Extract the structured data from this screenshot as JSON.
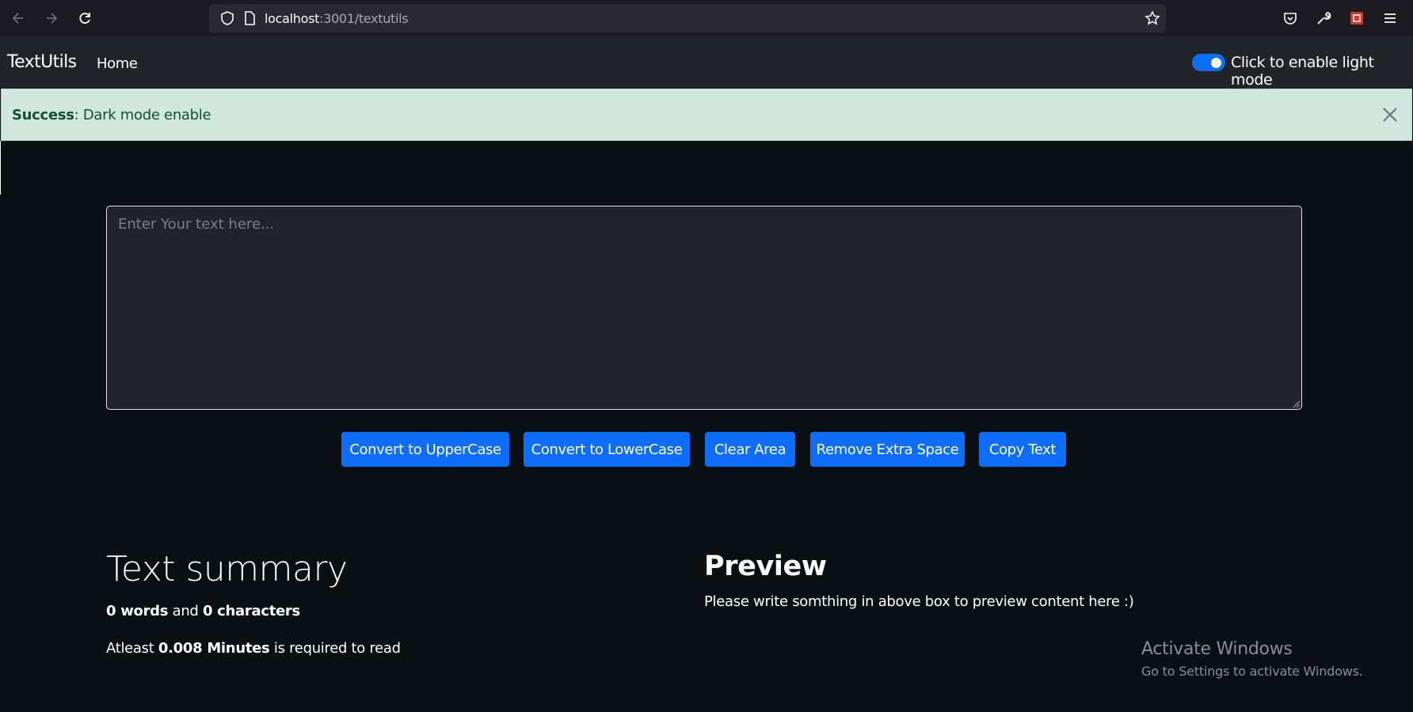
{
  "browser": {
    "url_host": "localhost",
    "url_path": ":3001/textutils"
  },
  "navbar": {
    "brand": "TextUtils",
    "home_link": "Home",
    "mode_toggle_label": "Click to enable light mode",
    "mode_toggle_on": true
  },
  "alert": {
    "title": "Success",
    "message": ": Dark mode enable"
  },
  "editor": {
    "placeholder": "Enter Your text here...",
    "value": ""
  },
  "buttons": {
    "uppercase": "Convert to UpperCase",
    "lowercase": "Convert to LowerCase",
    "clear": "Clear Area",
    "remove_space": "Remove Extra Space",
    "copy": "Copy Text"
  },
  "summary": {
    "title": "Text summary",
    "word_count": "0 words",
    "and_text": " and ",
    "char_count": "0 characters",
    "read_prefix": "Atleast ",
    "read_minutes": "0.008 Minutes",
    "read_suffix": " is required to read"
  },
  "preview": {
    "title": "Preview",
    "text": "Please write somthing in above box to preview content here :)"
  },
  "watermark": {
    "title": "Activate Windows",
    "subtitle": "Go to Settings to activate Windows."
  },
  "colors": {
    "page_bg": "#0b1015",
    "navbar_bg": "#212529",
    "primary": "#0d6efd",
    "alert_bg": "#d1e7dd",
    "alert_text": "#0f5132"
  }
}
